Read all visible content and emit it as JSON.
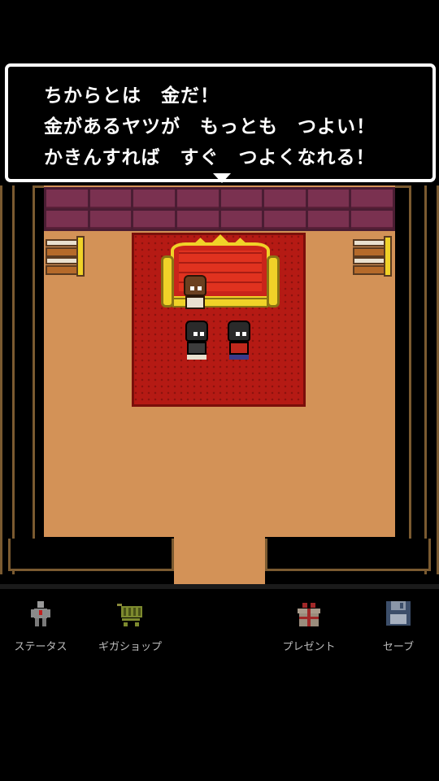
{
  "dialog": {
    "lines": [
      "ちからとは　金だ！",
      "金があるヤツが　もっとも　つよい！",
      "かきんすれば　すぐ　つよくなれる！"
    ],
    "continue_icon": "down-triangle-icon"
  },
  "menu": {
    "items": [
      {
        "label": "ステータス",
        "icon": "status-figure-icon"
      },
      {
        "label": "ギガショップ",
        "icon": "shopping-cart-icon"
      },
      {
        "label": "プレゼント",
        "icon": "gift-box-icon"
      },
      {
        "label": "セーブ",
        "icon": "floppy-disk-icon"
      }
    ]
  },
  "colors": {
    "floor": "#d39257",
    "carpet": "#b51a14",
    "throne_gold": "#f0d228",
    "brick": "#7a3150",
    "menu_label": "#bdbdbd"
  }
}
